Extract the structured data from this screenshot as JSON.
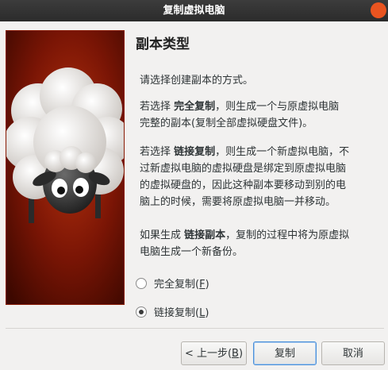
{
  "window": {
    "title": "复制虚拟电脑"
  },
  "page": {
    "title": "副本类型",
    "intro": "请选择创建副本的方式。",
    "full_clone": {
      "prefix": "若选择 ",
      "bold": "完全复制",
      "line1_rest": "，则生成一个与原虚拟电脑",
      "line2": "完整的副本(复制全部虚拟硬盘文件)。"
    },
    "linked_clone": {
      "prefix": "若选择 ",
      "bold": "链接复制",
      "line1_rest": "，则生成一个新虚拟电脑，不",
      "line2": "过新虚拟电脑的虚拟硬盘是绑定到原虚拟电脑",
      "line3": "的虚拟硬盘的，因此这种副本要移动到别的电",
      "line4": "脑上的时候，需要将原虚拟电脑一并移动。"
    },
    "backup_note": {
      "prefix": "如果生成 ",
      "bold": "链接副本",
      "line1_rest": "，复制的过程中将为原虚拟",
      "line2": "电脑生成一个新备份。"
    }
  },
  "options": {
    "full": {
      "label": "完全复制(",
      "key": "F",
      "end": ")",
      "selected": false
    },
    "linked": {
      "label": "链接复制(",
      "key": "L",
      "end": ")",
      "selected": true
    }
  },
  "buttons": {
    "back": {
      "label": "< 上一步(",
      "key": "B",
      "end": ")"
    },
    "clone": "复制",
    "cancel": "取消"
  },
  "colors": {
    "close_button": "#e95420",
    "panel_background": "#7a1505",
    "default_focus": "#4a90d9"
  }
}
